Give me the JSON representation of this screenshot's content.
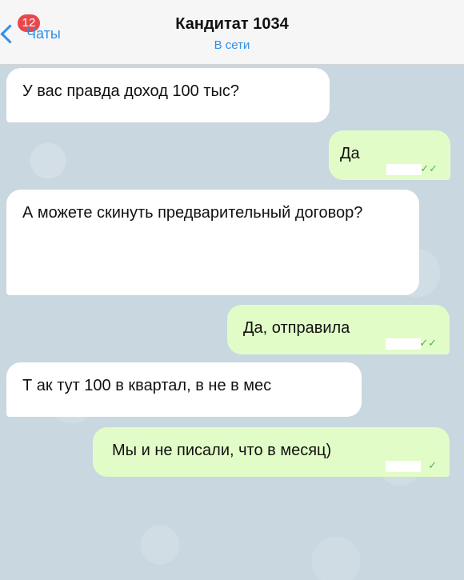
{
  "header": {
    "back_label": "Чаты",
    "unread_count": "12",
    "contact_name": "Кандитат 1034",
    "status": "В сети"
  },
  "messages": [
    {
      "direction": "in",
      "text": "У вас правда доход 100 тыс?"
    },
    {
      "direction": "out",
      "text": "Да",
      "checks": "✓✓"
    },
    {
      "direction": "in",
      "text": "А можете скинуть предварительный договор?"
    },
    {
      "direction": "out",
      "text": "Да, отправила",
      "checks": "✓✓"
    },
    {
      "direction": "in",
      "text": "Т ак тут 100 в квартал, в не в мес"
    },
    {
      "direction": "out",
      "text": "Мы и не писали, что в месяц)",
      "checks": "✓"
    }
  ],
  "colors": {
    "accent": "#2f90e6",
    "badge": "#e8484a",
    "outgoing_bubble": "#e2fcc7",
    "incoming_bubble": "#ffffff",
    "read_check": "#4cb64c"
  }
}
